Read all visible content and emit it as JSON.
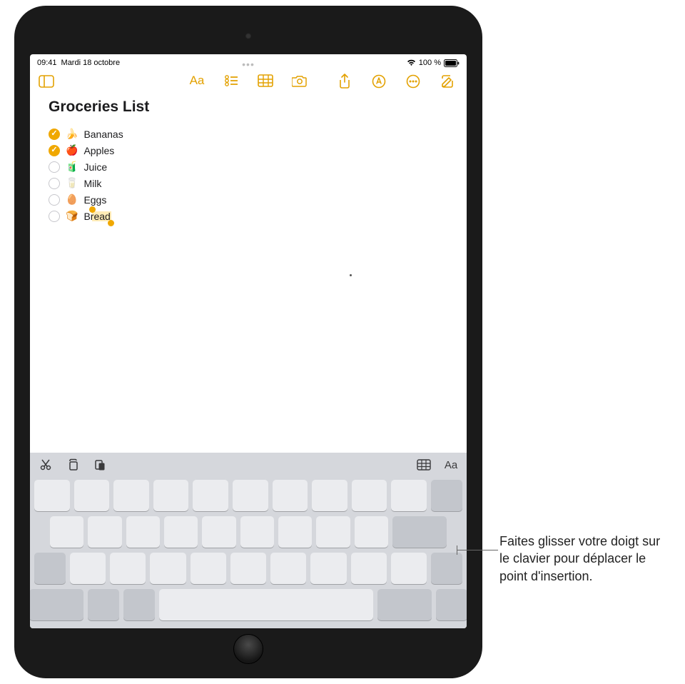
{
  "status": {
    "time": "09:41",
    "date": "Mardi 18 octobre",
    "battery_text": "100 %"
  },
  "toolbar": {
    "format_label": "Aa"
  },
  "note": {
    "title": "Groceries List",
    "items": [
      {
        "checked": true,
        "emoji": "🍌",
        "label": "Bananas"
      },
      {
        "checked": true,
        "emoji": "🍎",
        "label": "Apples"
      },
      {
        "checked": false,
        "emoji": "🧃",
        "label": "Juice"
      },
      {
        "checked": false,
        "emoji": "🥛",
        "label": "Milk"
      },
      {
        "checked": false,
        "emoji": "🥚",
        "label": "Eggs"
      },
      {
        "checked": false,
        "emoji": "🍞",
        "label": "Bread"
      }
    ],
    "selected_item_index": 5
  },
  "keyboard_toolbar": {
    "format_label": "Aa"
  },
  "callout": {
    "text": "Faites glisser votre doigt sur le clavier pour déplacer le point d'insertion."
  }
}
